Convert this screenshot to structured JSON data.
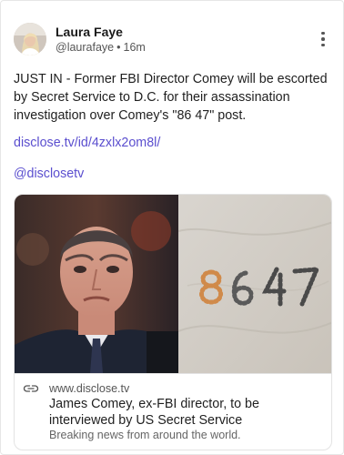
{
  "post": {
    "author_name": "Laura Faye",
    "author_handle": "@laurafaye",
    "separator": "•",
    "time_ago": "16m",
    "text": "JUST IN - Former FBI Director Comey will be escorted by Secret Service to D.C. for their assassination investigation over Comey's \"86 47\" post.",
    "link_url": "disclose.tv/id/4zxlx2om8l/",
    "mention": "@disclosetv"
  },
  "link_preview": {
    "domain": "www.disclose.tv",
    "headline": "James Comey, ex-FBI director, to be interviewed by US Secret Service",
    "description": "Breaking news from around the world.",
    "image_right_text": "8647"
  },
  "icons": {
    "menu": "more-vertical-icon",
    "link": "link-icon"
  },
  "colors": {
    "link": "#5b4fcf",
    "text": "#1f1f1f",
    "muted": "#555555"
  }
}
